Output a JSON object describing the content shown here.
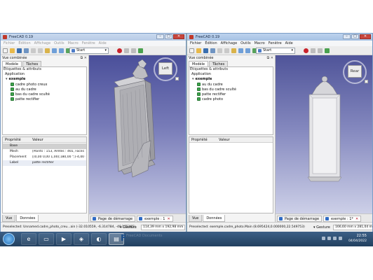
{
  "left_window": {
    "title": "FreeCAD 0.19",
    "menu": [
      "Fichier",
      "Édition",
      "Affichage",
      "Outils",
      "Macro",
      "Fenêtre",
      "Aide"
    ],
    "workbench": "Start",
    "combo_view": {
      "title": "Vue combinée",
      "tabs": [
        "Modèle",
        "Tâches"
      ],
      "tree_header": "Étiquettes & attributs",
      "app_label": "Application",
      "document": "exemple",
      "items": [
        "cadre photo creux",
        "au du cadre",
        "bas du cadre sculté",
        "patte rectifier"
      ],
      "properties": {
        "col_property": "Propriété",
        "col_value": "Valeur",
        "group": "Base",
        "rows": [
          {
            "name": "Mesh",
            "value": "[Points : 153, Arêtes : 465, Faces : 310]"
          },
          {
            "name": "Placement",
            "value": "[(0,00 0,00 1,00);180,00 °;(-4,00 -2,00 5,00)]"
          },
          {
            "name": "Label",
            "value": "patte rectifier"
          }
        ]
      },
      "bottom_tabs": [
        "Vue",
        "Données"
      ]
    },
    "navcube_face": "Left",
    "view_tabs": [
      "Page de démarrage",
      "exemple : 1"
    ],
    "status_message": "Preselected: Unnamed.cadre_photo_creu...ain (-32.010559, -6.314784, -40.175185)",
    "nav_style": "Gesture",
    "dimensions": "114,39 mm x 192,98 mm"
  },
  "right_window": {
    "title": "FreeCAD 0.19",
    "menu": [
      "Fichier",
      "Édition",
      "Affichage",
      "Outils",
      "Macro",
      "Fenêtre",
      "Aide"
    ],
    "workbench": "Start",
    "combo_view": {
      "title": "Vue combinée",
      "tabs": [
        "Modèle",
        "Tâches"
      ],
      "tree_header": "Étiquettes & attributs",
      "app_label": "Application",
      "document": "exemple",
      "items": [
        "au du cadre",
        "bas du cadre sculté",
        "patte rectifier",
        "cadre photo"
      ],
      "properties": {
        "col_property": "Propriété",
        "col_value": "Valeur"
      },
      "bottom_tabs": [
        "Vue",
        "Données"
      ]
    },
    "navcube_face": "Rear",
    "view_tabs": [
      "Page de démarrage",
      "exemple : 1*"
    ],
    "status_message": "Preselected: exemple.cadre_photo.Main (8.695424,0.000000,22.549753)",
    "nav_style": "Gesture",
    "dimensions": "166,60 mm x 281,04 mm"
  },
  "taskbar": {
    "time": "22:55",
    "date": "04/04/2022",
    "ghost_title": "FreeCAD Documents"
  },
  "colors": {
    "viewport_top": "#4a4f9a",
    "viewport_bottom": "#c5c8e4",
    "model_gray": "#b9b9bd"
  }
}
